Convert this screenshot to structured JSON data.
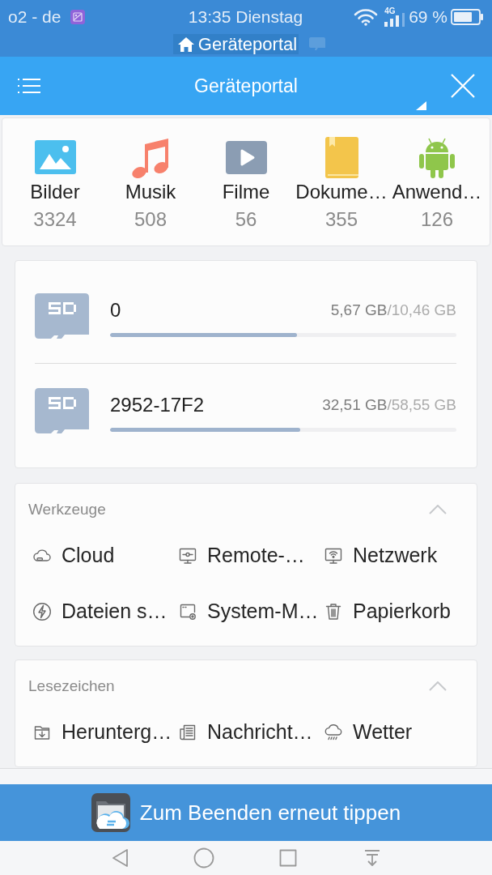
{
  "status_bar": {
    "carrier": "o2 - de",
    "time": "13:35 Dienstag",
    "network": "4G",
    "battery": "69 %"
  },
  "breadcrumb": {
    "label": "Geräteportal"
  },
  "app_bar": {
    "title": "Geräteportal"
  },
  "categories": [
    {
      "kind": "images",
      "label": "Bilder",
      "count": "3324"
    },
    {
      "kind": "music",
      "label": "Musik",
      "count": "508"
    },
    {
      "kind": "video",
      "label": "Filme",
      "count": "56"
    },
    {
      "kind": "documents",
      "label": "Dokume…",
      "count": "355"
    },
    {
      "kind": "apps",
      "label": "Anwend…",
      "count": "126"
    }
  ],
  "storage": [
    {
      "name": "0",
      "used": "5,67 GB",
      "total": "/10,46 GB",
      "level": 0.54
    },
    {
      "name": "2952-17F2",
      "used": "32,51 GB",
      "total": "/58,55 GB",
      "level": 0.55
    }
  ],
  "sections": [
    {
      "title": "Werkzeuge",
      "expanded": true,
      "items": [
        {
          "kind": "cloud",
          "label": "Cloud"
        },
        {
          "kind": "remote",
          "label": "Remote-…"
        },
        {
          "kind": "network",
          "label": "Netzwerk"
        },
        {
          "kind": "flash",
          "label": "Dateien s…"
        },
        {
          "kind": "system",
          "label": "System-M…"
        },
        {
          "kind": "trash",
          "label": "Papierkorb"
        }
      ]
    },
    {
      "title": "Lesezeichen",
      "expanded": true,
      "items": [
        {
          "kind": "download",
          "label": "Herunterg…"
        },
        {
          "kind": "news",
          "label": "Nachricht…"
        },
        {
          "kind": "weather",
          "label": "Wetter"
        }
      ]
    }
  ],
  "toast": {
    "message": "Zum Beenden erneut tippen"
  }
}
